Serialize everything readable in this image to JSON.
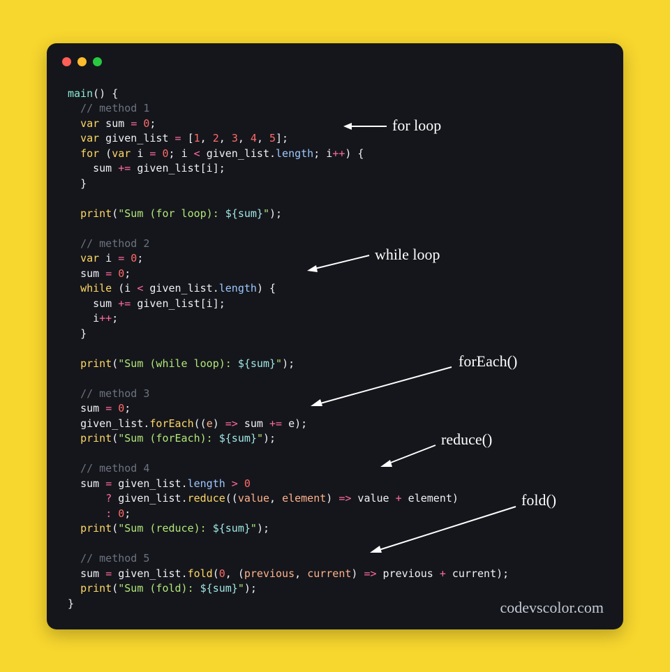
{
  "window": {
    "traffic_lights": [
      "red",
      "yellow",
      "green"
    ],
    "watermark": "codevscolor.com"
  },
  "annotations": {
    "for_loop": "for loop",
    "while_loop": "while loop",
    "foreach": "forEach()",
    "reduce": "reduce()",
    "fold": "fold()"
  },
  "code": {
    "l01": {
      "main": "main",
      "paren": "()",
      "brace": " {"
    },
    "l02": {
      "comment": "// method 1"
    },
    "l03": {
      "kw": "var",
      "name": " sum ",
      "eq": "=",
      "val": " 0",
      "semi": ";"
    },
    "l04": {
      "kw": "var",
      "name": " given_list ",
      "eq": "=",
      "open": " [",
      "n1": "1",
      "c": ", ",
      "n2": "2",
      "n3": "3",
      "n4": "4",
      "n5": "5",
      "close": "];"
    },
    "l05": {
      "for": "for",
      "open": " (",
      "var": "var",
      "iname": " i ",
      "eq": "=",
      "zero": " 0",
      "semi1": "; ",
      "i": "i",
      "lt": " < ",
      "list": "given_list",
      "dot": ".",
      "length": "length",
      "semi2": "; ",
      "i2": "i",
      "pp": "++",
      "close": ") {"
    },
    "l06": {
      "sum": "sum",
      "pluseq": " += ",
      "list": "given_list",
      "idx": "[i];"
    },
    "l07": {
      "brace": "}"
    },
    "l08": {
      "blank": ""
    },
    "l09": {
      "print": "print",
      "open": "(",
      "str1": "\"Sum (for loop): ",
      "emb": "${sum}",
      "str2": "\"",
      "close": ");"
    },
    "l10": {
      "blank": ""
    },
    "l11": {
      "comment": "// method 2"
    },
    "l12": {
      "kw": "var",
      "name": " i ",
      "eq": "=",
      "val": " 0",
      "semi": ";"
    },
    "l13": {
      "name": "sum ",
      "eq": "=",
      "val": " 0",
      "semi": ";"
    },
    "l14": {
      "while": "while",
      "open": " (",
      "i": "i",
      "lt": " < ",
      "list": "given_list",
      "dot": ".",
      "length": "length",
      "close": ") {"
    },
    "l15": {
      "sum": "sum",
      "pluseq": " += ",
      "list": "given_list",
      "idx": "[i];"
    },
    "l16": {
      "i": "i",
      "pp": "++",
      "semi": ";"
    },
    "l17": {
      "brace": "}"
    },
    "l18": {
      "blank": ""
    },
    "l19": {
      "print": "print",
      "open": "(",
      "str1": "\"Sum (while loop): ",
      "emb": "${sum}",
      "str2": "\"",
      "close": ");"
    },
    "l20": {
      "blank": ""
    },
    "l21": {
      "comment": "// method 3"
    },
    "l22": {
      "name": "sum ",
      "eq": "=",
      "val": " 0",
      "semi": ";"
    },
    "l23": {
      "list": "given_list",
      "dot": ".",
      "fn": "forEach",
      "open": "((",
      "e": "e",
      "close1": ") ",
      "arrow": "=>",
      "body": " sum ",
      "pluseq": "+=",
      "body2": " e);"
    },
    "l24": {
      "print": "print",
      "open": "(",
      "str1": "\"Sum (forEach): ",
      "emb": "${sum}",
      "str2": "\"",
      "close": ");"
    },
    "l25": {
      "blank": ""
    },
    "l26": {
      "comment": "// method 4"
    },
    "l27": {
      "name": "sum ",
      "eq": "=",
      "list": " given_list",
      "dot": ".",
      "length": "length",
      "gt": " > ",
      "zero": "0"
    },
    "l28": {
      "q": "? ",
      "list": "given_list",
      "dot": ".",
      "fn": "reduce",
      "open": "((",
      "value": "value",
      "c": ", ",
      "element": "element",
      "close": ") ",
      "arrow": "=>",
      "body": " value ",
      "plus": "+",
      "body2": " element)"
    },
    "l29": {
      "colon": ": ",
      "zero": "0",
      "semi": ";"
    },
    "l30": {
      "print": "print",
      "open": "(",
      "str1": "\"Sum (reduce): ",
      "emb": "${sum}",
      "str2": "\"",
      "close": ");"
    },
    "l31": {
      "blank": ""
    },
    "l32": {
      "comment": "// method 5"
    },
    "l33": {
      "name": "sum ",
      "eq": "=",
      "list": " given_list",
      "dot": ".",
      "fn": "fold",
      "open": "(",
      "zero": "0",
      "c": ", (",
      "previous": "previous",
      "c2": ", ",
      "current": "current",
      "close": ") ",
      "arrow": "=>",
      "body": " previous ",
      "plus": "+",
      "body2": " current);"
    },
    "l34": {
      "print": "print",
      "open": "(",
      "str1": "\"Sum (fold): ",
      "emb": "${sum}",
      "str2": "\"",
      "close": ");"
    },
    "l35": {
      "brace": "}"
    }
  }
}
